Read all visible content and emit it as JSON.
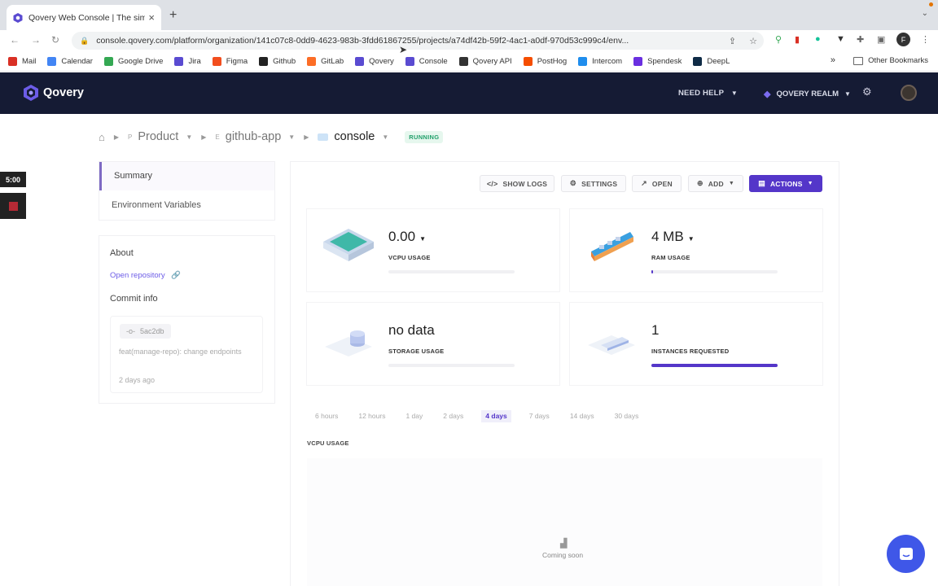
{
  "browser": {
    "tab_title": "Qovery Web Console | The sim...",
    "url": "console.qovery.com/platform/organization/141c07c8-0dd9-4623-983b-3fdd61867255/projects/a74df42b-59f2-4ac1-a0df-970d53c999c4/env...",
    "bookmarks": [
      {
        "label": "Mail",
        "color": "#d93025"
      },
      {
        "label": "Calendar",
        "color": "#4285f4"
      },
      {
        "label": "Google Drive",
        "color": "#34a853"
      },
      {
        "label": "Jira",
        "color": "#5a4bd1"
      },
      {
        "label": "Figma",
        "color": "#f24e1e"
      },
      {
        "label": "Github",
        "color": "#222222"
      },
      {
        "label": "GitLab",
        "color": "#fc6d26"
      },
      {
        "label": "Qovery",
        "color": "#5a4bd1"
      },
      {
        "label": "Console",
        "color": "#5a4bd1"
      },
      {
        "label": "Qovery API",
        "color": "#333333"
      },
      {
        "label": "PostHog",
        "color": "#f54e00"
      },
      {
        "label": "Intercom",
        "color": "#1f8ded"
      },
      {
        "label": "Spendesk",
        "color": "#6a2fe0"
      },
      {
        "label": "DeepL",
        "color": "#0f2b46"
      }
    ],
    "more_glyph": "»",
    "other_bookmarks": "Other Bookmarks"
  },
  "header": {
    "brand": "Qovery",
    "need_help": "NEED HELP",
    "realm": "QOVERY REALM"
  },
  "breadcrumb": {
    "project_prefix": "P",
    "project": "Product",
    "env_prefix": "E",
    "environment": "github-app",
    "application": "console",
    "status": "RUNNING"
  },
  "timer": "5:00",
  "sidebar": {
    "items": [
      {
        "label": "Summary"
      },
      {
        "label": "Environment Variables"
      }
    ],
    "about_title": "About",
    "open_repository": "Open repository",
    "commit_info_title": "Commit info",
    "commit": {
      "hash": "5ac2db",
      "message": "feat(manage-repo): change endpoints",
      "when": "2 days ago"
    }
  },
  "toolbar": {
    "show_logs": "SHOW LOGS",
    "settings": "SETTINGS",
    "open": "OPEN",
    "add": "ADD",
    "actions": "ACTIONS"
  },
  "metrics": [
    {
      "value": "0.00",
      "label": "VCPU USAGE",
      "fill": 0
    },
    {
      "value": "4 MB",
      "label": "RAM USAGE",
      "fill": 0.01
    },
    {
      "value": "no data",
      "label": "STORAGE USAGE",
      "fill": 0
    },
    {
      "value": "1",
      "label": "INSTANCES REQUESTED",
      "fill": 1
    }
  ],
  "time_ranges": [
    "6 hours",
    "12 hours",
    "1 day",
    "2 days",
    "4 days",
    "7 days",
    "14 days",
    "30 days"
  ],
  "selected_range": "4 days",
  "chart": {
    "title": "VCPU USAGE",
    "placeholder": "Coming soon"
  },
  "colors": {
    "accent": "#5436c9",
    "header_bg": "#151b34",
    "running": "#22a06b"
  }
}
